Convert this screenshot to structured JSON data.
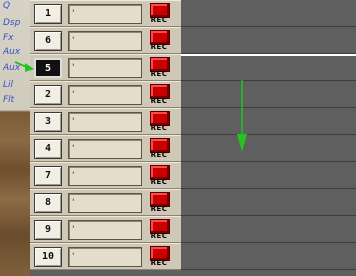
{
  "sidebar": {
    "labels": [
      "Q",
      "Dsp",
      "Fx",
      "Aux",
      "Aux",
      "Lil",
      "Flt"
    ]
  },
  "tracks": [
    {
      "number": "1",
      "name": "'",
      "rec_label": "REC",
      "selected": false
    },
    {
      "number": "6",
      "name": "'",
      "rec_label": "REC",
      "selected": false
    },
    {
      "number": "5",
      "name": "'",
      "rec_label": "REC",
      "selected": true
    },
    {
      "number": "2",
      "name": "'",
      "rec_label": "REC",
      "selected": false
    },
    {
      "number": "3",
      "name": "'",
      "rec_label": "REC",
      "selected": false
    },
    {
      "number": "4",
      "name": "'",
      "rec_label": "REC",
      "selected": false
    },
    {
      "number": "7",
      "name": "'",
      "rec_label": "REC",
      "selected": false
    },
    {
      "number": "8",
      "name": "'",
      "rec_label": "REC",
      "selected": false
    },
    {
      "number": "9",
      "name": "'",
      "rec_label": "REC",
      "selected": false
    },
    {
      "number": "10",
      "name": "'",
      "rec_label": "REC",
      "selected": false
    }
  ],
  "colors": {
    "accent_arrow": "#22c422",
    "rec_led": "#c80000",
    "lane_bg": "#5f5f5f",
    "panel_bg": "#cfc8b6"
  },
  "icons": {
    "drag_indicator": "green-right-arrow-icon",
    "drag_target": "green-down-arrow-icon"
  }
}
